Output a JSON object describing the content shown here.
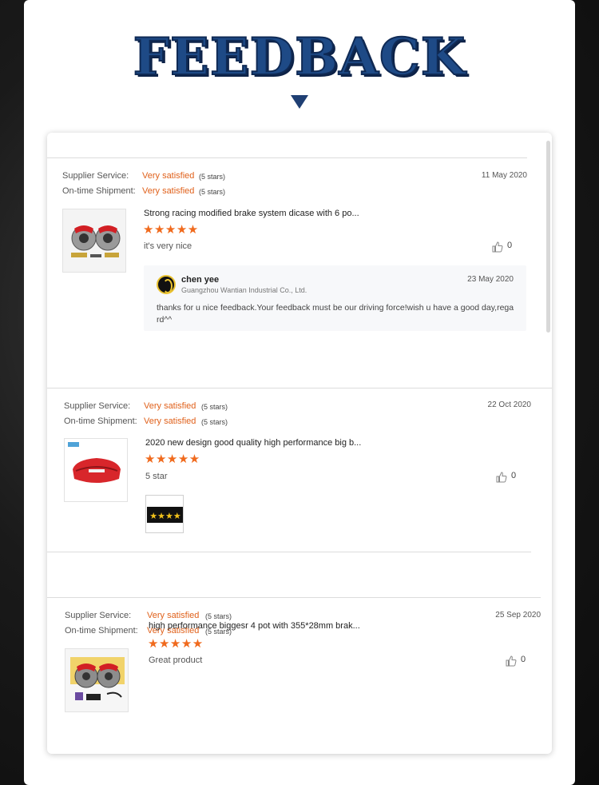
{
  "header": {
    "title": "FEEDBACK"
  },
  "reviews": [
    {
      "supplier_label": "Supplier Service:",
      "supplier_value": "Very satisfied",
      "supplier_stars": "(5 stars)",
      "shipment_label": "On-time Shipment:",
      "shipment_value": "Very satisfied",
      "shipment_stars": "(5 stars)",
      "date": "11 May 2020",
      "product_title": "Strong racing modified brake system dicase with 6 po...",
      "rating": 5,
      "star_glyphs": "★★★★★",
      "comment": "it's very nice",
      "likes": "0",
      "reply": {
        "name": "chen yee",
        "company": "Guangzhou Wantian Industrial Co., Ltd.",
        "date": "23 May 2020",
        "text": "thanks for u nice feedback.Your feedback must be our driving force!wish u have a good day,regard^^"
      }
    },
    {
      "supplier_label": "Supplier Service:",
      "supplier_value": "Very satisfied",
      "supplier_stars": "(5 stars)",
      "shipment_label": "On-time Shipment:",
      "shipment_value": "Very satisfied",
      "shipment_stars": "(5 stars)",
      "date": "22 Oct 2020",
      "product_title": "2020 new design good quality high performance big b...",
      "rating": 5,
      "star_glyphs": "★★★★★",
      "comment": "5 star",
      "likes": "0"
    },
    {
      "supplier_label": "Supplier Service:",
      "supplier_value": "Very satisfied",
      "supplier_stars": "(5 stars)",
      "shipment_label": "On-time Shipment:",
      "shipment_value": "Very satisfied",
      "shipment_stars": "(5 stars)",
      "date": "25 Sep 2020",
      "product_title": "high performance biggesr 4 pot with 355*28mm brak...",
      "rating": 5,
      "star_glyphs": "★★★★★",
      "comment": "Great product",
      "likes": "0"
    }
  ],
  "colors": {
    "title": "#1e4a86",
    "accent": "#e0611b",
    "star": "#f06a1d"
  }
}
